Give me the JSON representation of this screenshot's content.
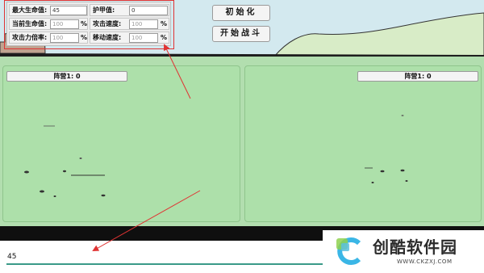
{
  "stats": {
    "max_hp": {
      "label": "最大生命值:",
      "value": "45"
    },
    "armor": {
      "label": "护甲值:",
      "value": "0"
    },
    "current_hp": {
      "label": "当前生命值:",
      "value": "100",
      "unit": "%"
    },
    "attack_speed": {
      "label": "攻击速度:",
      "value": "100",
      "unit": "%"
    },
    "attack_mult": {
      "label": "攻击力倍率:",
      "value": "100",
      "unit": "%"
    },
    "move_speed": {
      "label": "移动速度:",
      "value": "100",
      "unit": "%"
    }
  },
  "buttons": {
    "init": "初始化",
    "start": "开始战斗"
  },
  "teams": {
    "left": "阵营1: 0",
    "right": "阵营1: 0"
  },
  "bottom": {
    "value": "45"
  },
  "logo": {
    "name": "创酷软件园",
    "url": "WWW.CKZXJ.COM"
  },
  "colors": {
    "sky": "#d3e9ef",
    "ground": "#b2deaf",
    "panel": "#ade0aa",
    "highlight": "#e03333",
    "line": "#3a9a88"
  }
}
